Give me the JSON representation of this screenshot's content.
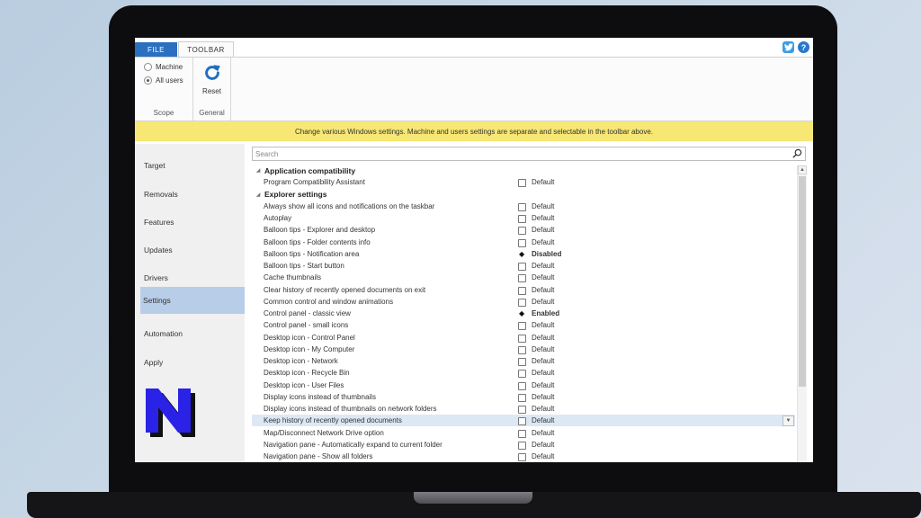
{
  "ribbon": {
    "tabs": [
      "FILE",
      "TOOLBAR"
    ],
    "scope": {
      "options": [
        "Machine",
        "All users"
      ],
      "selected": "All users",
      "label": "Scope"
    },
    "general": {
      "reset_label": "Reset",
      "label": "General"
    }
  },
  "banner": "Change various Windows settings. Machine and users settings are separate and selectable in the toolbar above.",
  "sidebar": {
    "items": [
      "Target",
      "Removals",
      "Features",
      "Updates",
      "Drivers",
      "Settings",
      "Automation",
      "Apply"
    ],
    "active": "Settings"
  },
  "search": {
    "placeholder": "Search"
  },
  "groups": [
    {
      "title": "Application compatibility",
      "rows": [
        {
          "name": "Program Compatibility Assistant",
          "value": "Default"
        }
      ]
    },
    {
      "title": "Explorer settings",
      "rows": [
        {
          "name": "Always show all icons and notifications on the taskbar",
          "value": "Default"
        },
        {
          "name": "Autoplay",
          "value": "Default"
        },
        {
          "name": "Balloon tips - Explorer and desktop",
          "value": "Default"
        },
        {
          "name": "Balloon tips - Folder contents info",
          "value": "Default"
        },
        {
          "name": "Balloon tips - Notification area",
          "value": "Disabled"
        },
        {
          "name": "Balloon tips - Start button",
          "value": "Default"
        },
        {
          "name": "Cache thumbnails",
          "value": "Default"
        },
        {
          "name": "Clear history of recently opened documents on exit",
          "value": "Default"
        },
        {
          "name": "Common control and window animations",
          "value": "Default"
        },
        {
          "name": "Control panel - classic view",
          "value": "Enabled"
        },
        {
          "name": "Control panel - small icons",
          "value": "Default"
        },
        {
          "name": "Desktop icon - Control Panel",
          "value": "Default"
        },
        {
          "name": "Desktop icon - My Computer",
          "value": "Default"
        },
        {
          "name": "Desktop icon - Network",
          "value": "Default"
        },
        {
          "name": "Desktop icon - Recycle Bin",
          "value": "Default"
        },
        {
          "name": "Desktop icon - User Files",
          "value": "Default"
        },
        {
          "name": "Display icons instead of thumbnails",
          "value": "Default"
        },
        {
          "name": "Display icons instead of thumbnails on network folders",
          "value": "Default"
        },
        {
          "name": "Keep history of recently opened documents",
          "value": "Default",
          "selected": true
        },
        {
          "name": "Map/Disconnect Network Drive option",
          "value": "Default"
        },
        {
          "name": "Navigation pane - Automatically expand to current folder",
          "value": "Default"
        },
        {
          "name": "Navigation pane - Show all folders",
          "value": "Default"
        }
      ]
    }
  ],
  "colors": {
    "accent": "#2a6fc0",
    "banner": "#f7e774",
    "selection": "#b8cde8",
    "logo": "#2a22e6"
  }
}
